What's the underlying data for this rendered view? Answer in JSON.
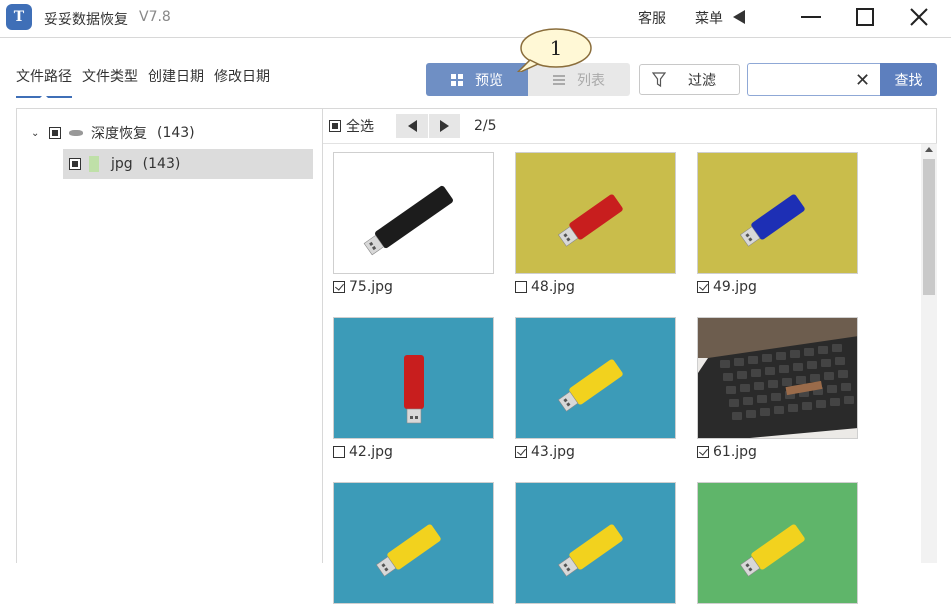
{
  "app": {
    "title": "妥妥数据恢复",
    "version": "V7.8",
    "logo_text": "T"
  },
  "titlebar": {
    "service_label": "客服",
    "menu_label": "菜单",
    "icons": [
      "minimize-icon",
      "maximize-icon",
      "close-icon"
    ]
  },
  "tabs": [
    {
      "label": "文件路径",
      "active": true
    },
    {
      "label": "文件类型",
      "active": false
    },
    {
      "label": "创建日期",
      "active": false
    },
    {
      "label": "修改日期",
      "active": false
    }
  ],
  "view_toggle": {
    "preview_label": "预览",
    "list_label": "列表",
    "selected": "preview"
  },
  "callout": {
    "label": "1"
  },
  "filter": {
    "label": "过滤"
  },
  "search": {
    "value": "",
    "placeholder": "",
    "button_label": "查找"
  },
  "tree": {
    "root": {
      "label": "深度恢复",
      "count": "(143)"
    },
    "child": {
      "label": "jpg",
      "count": "(143)"
    }
  },
  "toolbar": {
    "select_all_label": "全选",
    "page": "2/5"
  },
  "thumbnails": [
    {
      "name": "75.jpg",
      "checked": true,
      "bg": "#ffffff",
      "item": "black"
    },
    {
      "name": "48.jpg",
      "checked": false,
      "bg": "#c9bd4b",
      "item": "red"
    },
    {
      "name": "49.jpg",
      "checked": true,
      "bg": "#c9bd4b",
      "item": "blue"
    },
    {
      "name": "42.jpg",
      "checked": false,
      "bg": "#3c9bb8",
      "item": "red"
    },
    {
      "name": "43.jpg",
      "checked": true,
      "bg": "#3c9bb8",
      "item": "yellow"
    },
    {
      "name": "61.jpg",
      "checked": true,
      "bg": "#6d5d4e",
      "item": "keyboard"
    },
    {
      "name": "",
      "checked": false,
      "bg": "#3c9bb8",
      "item": "yellow"
    },
    {
      "name": "",
      "checked": false,
      "bg": "#3c9bb8",
      "item": "yellow"
    },
    {
      "name": "",
      "checked": false,
      "bg": "#5fb56a",
      "item": "yellow"
    }
  ],
  "colors": {
    "accent": "#3f6fb7",
    "preview_active": "#6f8fc4",
    "search_button": "#5d7fbe"
  }
}
